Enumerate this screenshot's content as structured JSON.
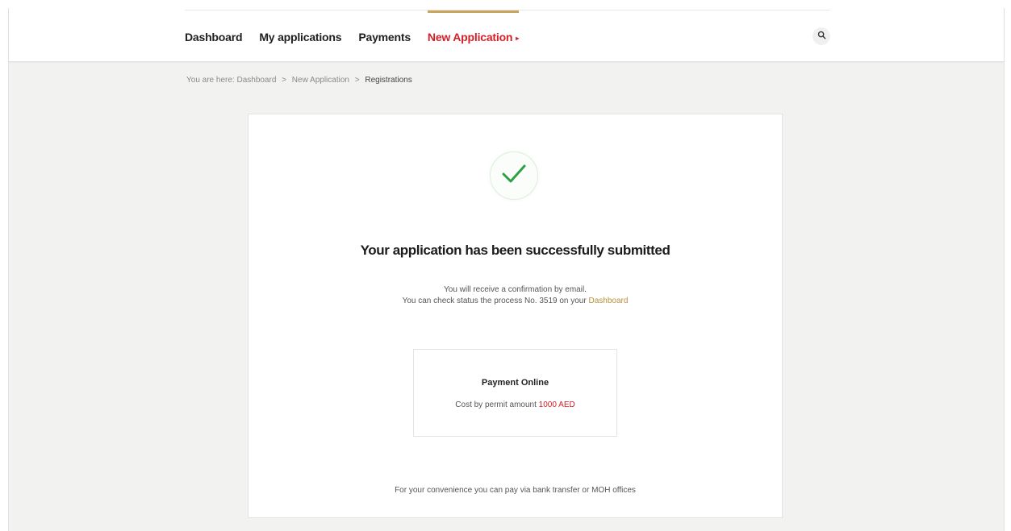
{
  "nav": {
    "items": [
      {
        "label": "Dashboard"
      },
      {
        "label": "My applications"
      },
      {
        "label": "Payments"
      },
      {
        "label": "New Application"
      }
    ],
    "active_caret": "▸"
  },
  "breadcrumb": {
    "prefix": "You are here:",
    "items": [
      "Dashboard",
      "New Application",
      "Registrations"
    ],
    "separator": ">"
  },
  "confirmation": {
    "title": "Your application has been successfully submitted",
    "line1": "You will receive a confirmation by email.",
    "line2_prefix": "You can check status the process No. 3519 on your",
    "line2_link": "Dashboard"
  },
  "payment": {
    "title": "Payment Online",
    "cost_prefix": "Cost by permit amount",
    "amount": "1000 AED"
  },
  "footer_note": "For your convenience you can pay via bank transfer or MOH offices",
  "colors": {
    "accent_red": "#d32027",
    "accent_gold": "#b9903f",
    "success_green": "#2ea043",
    "background": "#f2f2f1"
  },
  "icons": {
    "search": "search-icon",
    "success": "checkmark-icon"
  }
}
